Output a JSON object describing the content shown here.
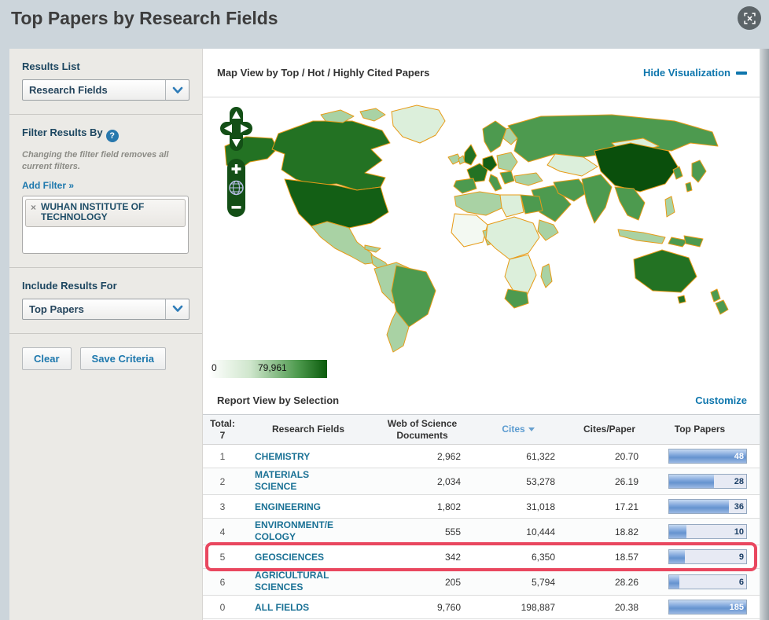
{
  "header": {
    "title": "Top Papers by Research Fields"
  },
  "sidebar": {
    "results_list": {
      "label": "Results List",
      "selected": "Research Fields"
    },
    "filter": {
      "title": "Filter Results By",
      "help_glyph": "?",
      "caption": "Changing the filter field removes all current filters.",
      "add_filter": "Add Filter »",
      "chip": {
        "remove_glyph": "×",
        "label": "WUHAN INSTITUTE OF TECHNOLOGY"
      }
    },
    "include": {
      "label": "Include Results For",
      "selected": "Top Papers"
    },
    "buttons": {
      "clear": "Clear",
      "save": "Save Criteria"
    }
  },
  "map": {
    "title": "Map View by Top / Hot / Highly Cited Papers",
    "hide_link": "Hide Visualization",
    "legend": {
      "min": "0",
      "max": "79,961"
    }
  },
  "report": {
    "title": "Report View by Selection",
    "customize": "Customize"
  },
  "table": {
    "headers": {
      "total": "Total:",
      "total_count": "7",
      "field": "Research Fields",
      "docs": "Web of Science Documents",
      "cites": "Cites",
      "cites_paper": "Cites/Paper",
      "top_papers": "Top Papers"
    },
    "rows": [
      {
        "rank": "1",
        "field": "CHEMISTRY",
        "docs": "2,962",
        "cites": "61,322",
        "cites_per_paper": "20.70",
        "top_papers": "48",
        "bar_pct": 100,
        "label_white": true
      },
      {
        "rank": "2",
        "field": "MATERIALS SCIENCE",
        "docs": "2,034",
        "cites": "53,278",
        "cites_per_paper": "26.19",
        "top_papers": "28",
        "bar_pct": 58
      },
      {
        "rank": "3",
        "field": "ENGINEERING",
        "docs": "1,802",
        "cites": "31,018",
        "cites_per_paper": "17.21",
        "top_papers": "36",
        "bar_pct": 78
      },
      {
        "rank": "4",
        "field": "ENVIRONMENT/ECOLOGY",
        "docs": "555",
        "cites": "10,444",
        "cites_per_paper": "18.82",
        "top_papers": "10",
        "bar_pct": 22
      },
      {
        "rank": "5",
        "field": "GEOSCIENCES",
        "docs": "342",
        "cites": "6,350",
        "cites_per_paper": "18.57",
        "top_papers": "9",
        "bar_pct": 20,
        "highlighted": true
      },
      {
        "rank": "6",
        "field": "AGRICULTURAL SCIENCES",
        "docs": "205",
        "cites": "5,794",
        "cites_per_paper": "28.26",
        "top_papers": "6",
        "bar_pct": 13
      },
      {
        "rank": "0",
        "field": "ALL FIELDS",
        "docs": "9,760",
        "cites": "198,887",
        "cites_per_paper": "20.38",
        "top_papers": "185",
        "bar_pct": 100,
        "label_white": true
      }
    ]
  },
  "colors": {
    "page_bg": "#ccd5db",
    "sidebar_bg": "#ebeae6",
    "link_blue": "#0e76ad",
    "field_link": "#1a7195",
    "bar_fill": "#6593cf",
    "highlight_ring": "#e9475f",
    "map_border": "#e79b17",
    "map_dark_green": "#0a4f0c",
    "map_light_green": "#dcefdb"
  }
}
